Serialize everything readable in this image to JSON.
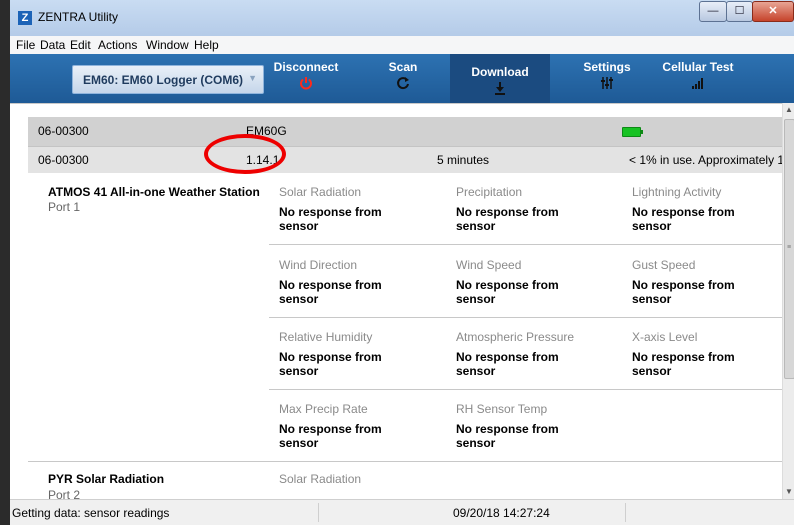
{
  "window": {
    "logo": "Z",
    "title": "ZENTRA Utility",
    "min": "—",
    "max": "☐",
    "close": "✕"
  },
  "menu": [
    "File",
    "Data",
    "Edit",
    "Actions",
    "Window",
    "Help"
  ],
  "toolbar": {
    "device": "EM60: EM60 Logger (COM6)",
    "buttons": [
      {
        "label": "Disconnect",
        "icon": "power-icon"
      },
      {
        "label": "Scan",
        "icon": "refresh-icon"
      },
      {
        "label": "Download",
        "icon": "download-icon"
      },
      {
        "label": "Settings",
        "icon": "sliders-icon"
      },
      {
        "label": "Cellular Test",
        "icon": "signal-bars-icon"
      }
    ]
  },
  "header_rows": {
    "row1": {
      "serial": "06-00300",
      "model": "EM60G",
      "battery_icon": "battery-full-icon"
    },
    "row2": {
      "serial": "06-00300",
      "firmware": "1.14.1",
      "interval": "5 minutes",
      "memory": "< 1% in use.  Approximately 1"
    }
  },
  "sensors": [
    {
      "name": "ATMOS 41 All-in-one Weather Station",
      "port": "Port 1",
      "measurements": [
        {
          "label": "Solar Radiation",
          "value": "No response from sensor"
        },
        {
          "label": "Precipitation",
          "value": "No response from sensor"
        },
        {
          "label": "Lightning Activity",
          "value": "No response from sensor"
        },
        {
          "label": "Wind Direction",
          "value": "No response from sensor"
        },
        {
          "label": "Wind Speed",
          "value": "No response from sensor"
        },
        {
          "label": "Gust Speed",
          "value": "No response from sensor"
        },
        {
          "label": "Relative Humidity",
          "value": "No response from sensor"
        },
        {
          "label": "Atmospheric Pressure",
          "value": "No response from sensor"
        },
        {
          "label": "X-axis Level",
          "value": "No response from sensor"
        },
        {
          "label": "Max Precip Rate",
          "value": "No response from sensor"
        },
        {
          "label": "RH Sensor Temp",
          "value": "No response from sensor"
        }
      ]
    },
    {
      "name": "PYR Solar Radiation",
      "port": "Port 2",
      "measurements": [
        {
          "label": "Solar Radiation",
          "value": ""
        }
      ]
    }
  ],
  "statusbar": {
    "message": "Getting data: sensor readings",
    "timestamp": "09/20/18 14:27:24"
  },
  "colors": {
    "toolbar": "#2468a8",
    "accent_red": "#e00000",
    "battery": "#17c223"
  }
}
